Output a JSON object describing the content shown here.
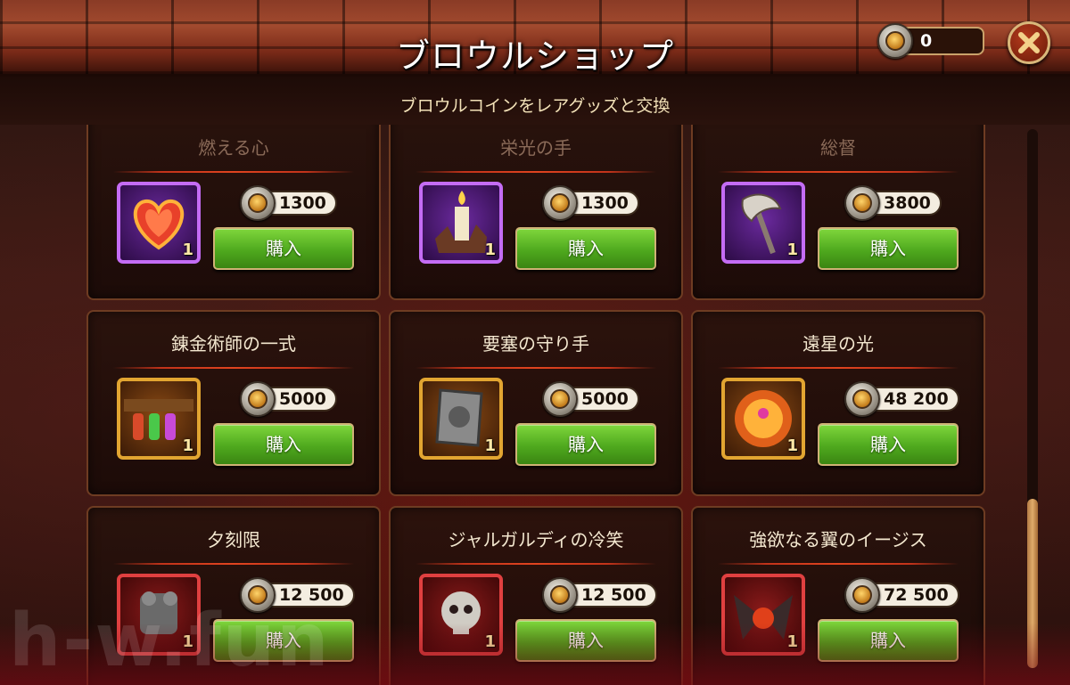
{
  "header": {
    "title": "ブロウルショップ",
    "subtitle": "ブロウルコインをレアグッズと交換",
    "currency_amount": "0",
    "close_icon": "close-x-icon"
  },
  "items": [
    {
      "name": "燃える心",
      "price": "1300",
      "qty": "1",
      "frame": "purple",
      "icon": "flaming-heart-icon",
      "buy_label": "購入"
    },
    {
      "name": "栄光の手",
      "price": "1300",
      "qty": "1",
      "frame": "purple",
      "icon": "candle-hand-icon",
      "buy_label": "購入"
    },
    {
      "name": "総督",
      "price": "3800",
      "qty": "1",
      "frame": "purple",
      "icon": "axe-icon",
      "buy_label": "購入"
    },
    {
      "name": "錬金術師の一式",
      "price": "5000",
      "qty": "1",
      "frame": "gold",
      "icon": "potion-belt-icon",
      "buy_label": "購入"
    },
    {
      "name": "要塞の守り手",
      "price": "5000",
      "qty": "1",
      "frame": "gold",
      "icon": "shield-plate-icon",
      "buy_label": "購入"
    },
    {
      "name": "遠星の光",
      "price": "48 200",
      "qty": "1",
      "frame": "gold",
      "icon": "fire-orb-icon",
      "buy_label": "購入"
    },
    {
      "name": "夕刻限",
      "price": "12 500",
      "qty": "1",
      "frame": "red",
      "icon": "armor-icon",
      "buy_label": "購入"
    },
    {
      "name": "ジャルガルディの冷笑",
      "price": "12 500",
      "qty": "1",
      "frame": "red",
      "icon": "skull-icon",
      "buy_label": "購入"
    },
    {
      "name": "強欲なる翼のイージス",
      "price": "72 500",
      "qty": "1",
      "frame": "red",
      "icon": "winged-aegis-icon",
      "buy_label": "購入"
    }
  ],
  "watermark": "h-w.fun"
}
